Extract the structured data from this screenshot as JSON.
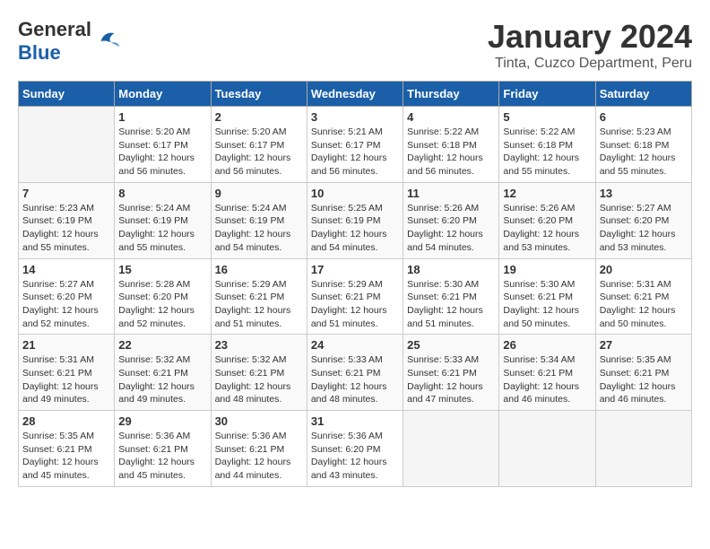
{
  "header": {
    "logo_general": "General",
    "logo_blue": "Blue",
    "title": "January 2024",
    "subtitle": "Tinta, Cuzco Department, Peru"
  },
  "calendar": {
    "headers": [
      "Sunday",
      "Monday",
      "Tuesday",
      "Wednesday",
      "Thursday",
      "Friday",
      "Saturday"
    ],
    "weeks": [
      [
        {
          "day": "",
          "sunrise": "",
          "sunset": "",
          "daylight": ""
        },
        {
          "day": "1",
          "sunrise": "Sunrise: 5:20 AM",
          "sunset": "Sunset: 6:17 PM",
          "daylight": "Daylight: 12 hours and 56 minutes."
        },
        {
          "day": "2",
          "sunrise": "Sunrise: 5:20 AM",
          "sunset": "Sunset: 6:17 PM",
          "daylight": "Daylight: 12 hours and 56 minutes."
        },
        {
          "day": "3",
          "sunrise": "Sunrise: 5:21 AM",
          "sunset": "Sunset: 6:17 PM",
          "daylight": "Daylight: 12 hours and 56 minutes."
        },
        {
          "day": "4",
          "sunrise": "Sunrise: 5:22 AM",
          "sunset": "Sunset: 6:18 PM",
          "daylight": "Daylight: 12 hours and 56 minutes."
        },
        {
          "day": "5",
          "sunrise": "Sunrise: 5:22 AM",
          "sunset": "Sunset: 6:18 PM",
          "daylight": "Daylight: 12 hours and 55 minutes."
        },
        {
          "day": "6",
          "sunrise": "Sunrise: 5:23 AM",
          "sunset": "Sunset: 6:18 PM",
          "daylight": "Daylight: 12 hours and 55 minutes."
        }
      ],
      [
        {
          "day": "7",
          "sunrise": "Sunrise: 5:23 AM",
          "sunset": "Sunset: 6:19 PM",
          "daylight": "Daylight: 12 hours and 55 minutes."
        },
        {
          "day": "8",
          "sunrise": "Sunrise: 5:24 AM",
          "sunset": "Sunset: 6:19 PM",
          "daylight": "Daylight: 12 hours and 55 minutes."
        },
        {
          "day": "9",
          "sunrise": "Sunrise: 5:24 AM",
          "sunset": "Sunset: 6:19 PM",
          "daylight": "Daylight: 12 hours and 54 minutes."
        },
        {
          "day": "10",
          "sunrise": "Sunrise: 5:25 AM",
          "sunset": "Sunset: 6:19 PM",
          "daylight": "Daylight: 12 hours and 54 minutes."
        },
        {
          "day": "11",
          "sunrise": "Sunrise: 5:26 AM",
          "sunset": "Sunset: 6:20 PM",
          "daylight": "Daylight: 12 hours and 54 minutes."
        },
        {
          "day": "12",
          "sunrise": "Sunrise: 5:26 AM",
          "sunset": "Sunset: 6:20 PM",
          "daylight": "Daylight: 12 hours and 53 minutes."
        },
        {
          "day": "13",
          "sunrise": "Sunrise: 5:27 AM",
          "sunset": "Sunset: 6:20 PM",
          "daylight": "Daylight: 12 hours and 53 minutes."
        }
      ],
      [
        {
          "day": "14",
          "sunrise": "Sunrise: 5:27 AM",
          "sunset": "Sunset: 6:20 PM",
          "daylight": "Daylight: 12 hours and 52 minutes."
        },
        {
          "day": "15",
          "sunrise": "Sunrise: 5:28 AM",
          "sunset": "Sunset: 6:20 PM",
          "daylight": "Daylight: 12 hours and 52 minutes."
        },
        {
          "day": "16",
          "sunrise": "Sunrise: 5:29 AM",
          "sunset": "Sunset: 6:21 PM",
          "daylight": "Daylight: 12 hours and 51 minutes."
        },
        {
          "day": "17",
          "sunrise": "Sunrise: 5:29 AM",
          "sunset": "Sunset: 6:21 PM",
          "daylight": "Daylight: 12 hours and 51 minutes."
        },
        {
          "day": "18",
          "sunrise": "Sunrise: 5:30 AM",
          "sunset": "Sunset: 6:21 PM",
          "daylight": "Daylight: 12 hours and 51 minutes."
        },
        {
          "day": "19",
          "sunrise": "Sunrise: 5:30 AM",
          "sunset": "Sunset: 6:21 PM",
          "daylight": "Daylight: 12 hours and 50 minutes."
        },
        {
          "day": "20",
          "sunrise": "Sunrise: 5:31 AM",
          "sunset": "Sunset: 6:21 PM",
          "daylight": "Daylight: 12 hours and 50 minutes."
        }
      ],
      [
        {
          "day": "21",
          "sunrise": "Sunrise: 5:31 AM",
          "sunset": "Sunset: 6:21 PM",
          "daylight": "Daylight: 12 hours and 49 minutes."
        },
        {
          "day": "22",
          "sunrise": "Sunrise: 5:32 AM",
          "sunset": "Sunset: 6:21 PM",
          "daylight": "Daylight: 12 hours and 49 minutes."
        },
        {
          "day": "23",
          "sunrise": "Sunrise: 5:32 AM",
          "sunset": "Sunset: 6:21 PM",
          "daylight": "Daylight: 12 hours and 48 minutes."
        },
        {
          "day": "24",
          "sunrise": "Sunrise: 5:33 AM",
          "sunset": "Sunset: 6:21 PM",
          "daylight": "Daylight: 12 hours and 48 minutes."
        },
        {
          "day": "25",
          "sunrise": "Sunrise: 5:33 AM",
          "sunset": "Sunset: 6:21 PM",
          "daylight": "Daylight: 12 hours and 47 minutes."
        },
        {
          "day": "26",
          "sunrise": "Sunrise: 5:34 AM",
          "sunset": "Sunset: 6:21 PM",
          "daylight": "Daylight: 12 hours and 46 minutes."
        },
        {
          "day": "27",
          "sunrise": "Sunrise: 5:35 AM",
          "sunset": "Sunset: 6:21 PM",
          "daylight": "Daylight: 12 hours and 46 minutes."
        }
      ],
      [
        {
          "day": "28",
          "sunrise": "Sunrise: 5:35 AM",
          "sunset": "Sunset: 6:21 PM",
          "daylight": "Daylight: 12 hours and 45 minutes."
        },
        {
          "day": "29",
          "sunrise": "Sunrise: 5:36 AM",
          "sunset": "Sunset: 6:21 PM",
          "daylight": "Daylight: 12 hours and 45 minutes."
        },
        {
          "day": "30",
          "sunrise": "Sunrise: 5:36 AM",
          "sunset": "Sunset: 6:21 PM",
          "daylight": "Daylight: 12 hours and 44 minutes."
        },
        {
          "day": "31",
          "sunrise": "Sunrise: 5:36 AM",
          "sunset": "Sunset: 6:20 PM",
          "daylight": "Daylight: 12 hours and 43 minutes."
        },
        {
          "day": "",
          "sunrise": "",
          "sunset": "",
          "daylight": ""
        },
        {
          "day": "",
          "sunrise": "",
          "sunset": "",
          "daylight": ""
        },
        {
          "day": "",
          "sunrise": "",
          "sunset": "",
          "daylight": ""
        }
      ]
    ]
  }
}
